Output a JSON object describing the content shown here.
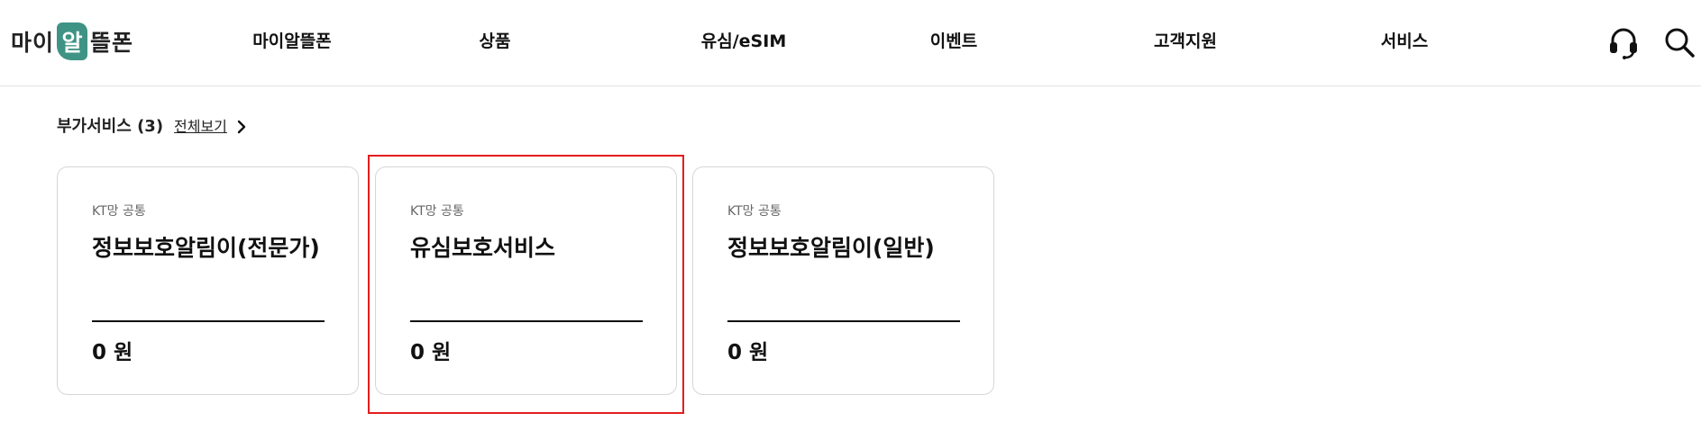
{
  "header": {
    "logo": {
      "pre": "마이",
      "mark": "알",
      "post": "뜰폰"
    },
    "nav": [
      {
        "label": "마이알뜰폰"
      },
      {
        "label": "상품"
      },
      {
        "label": "유심/eSIM"
      },
      {
        "label": "이벤트"
      },
      {
        "label": "고객지원"
      },
      {
        "label": "서비스"
      }
    ],
    "icons": {
      "support": "headset-icon",
      "search": "search-icon"
    }
  },
  "section": {
    "title": "부가서비스 (3)",
    "view_all": "전체보기"
  },
  "cards": [
    {
      "tag": "KT망 공통",
      "name": "정보보호알림이(전문가)",
      "price": "0 원"
    },
    {
      "tag": "KT망 공통",
      "name": "유심보호서비스",
      "price": "0 원"
    },
    {
      "tag": "KT망 공통",
      "name": "정보보호알림이(일반)",
      "price": "0 원"
    }
  ],
  "colors": {
    "brand": "#3f9384",
    "highlight": "#e41d1d",
    "border": "#d6d6d6"
  }
}
